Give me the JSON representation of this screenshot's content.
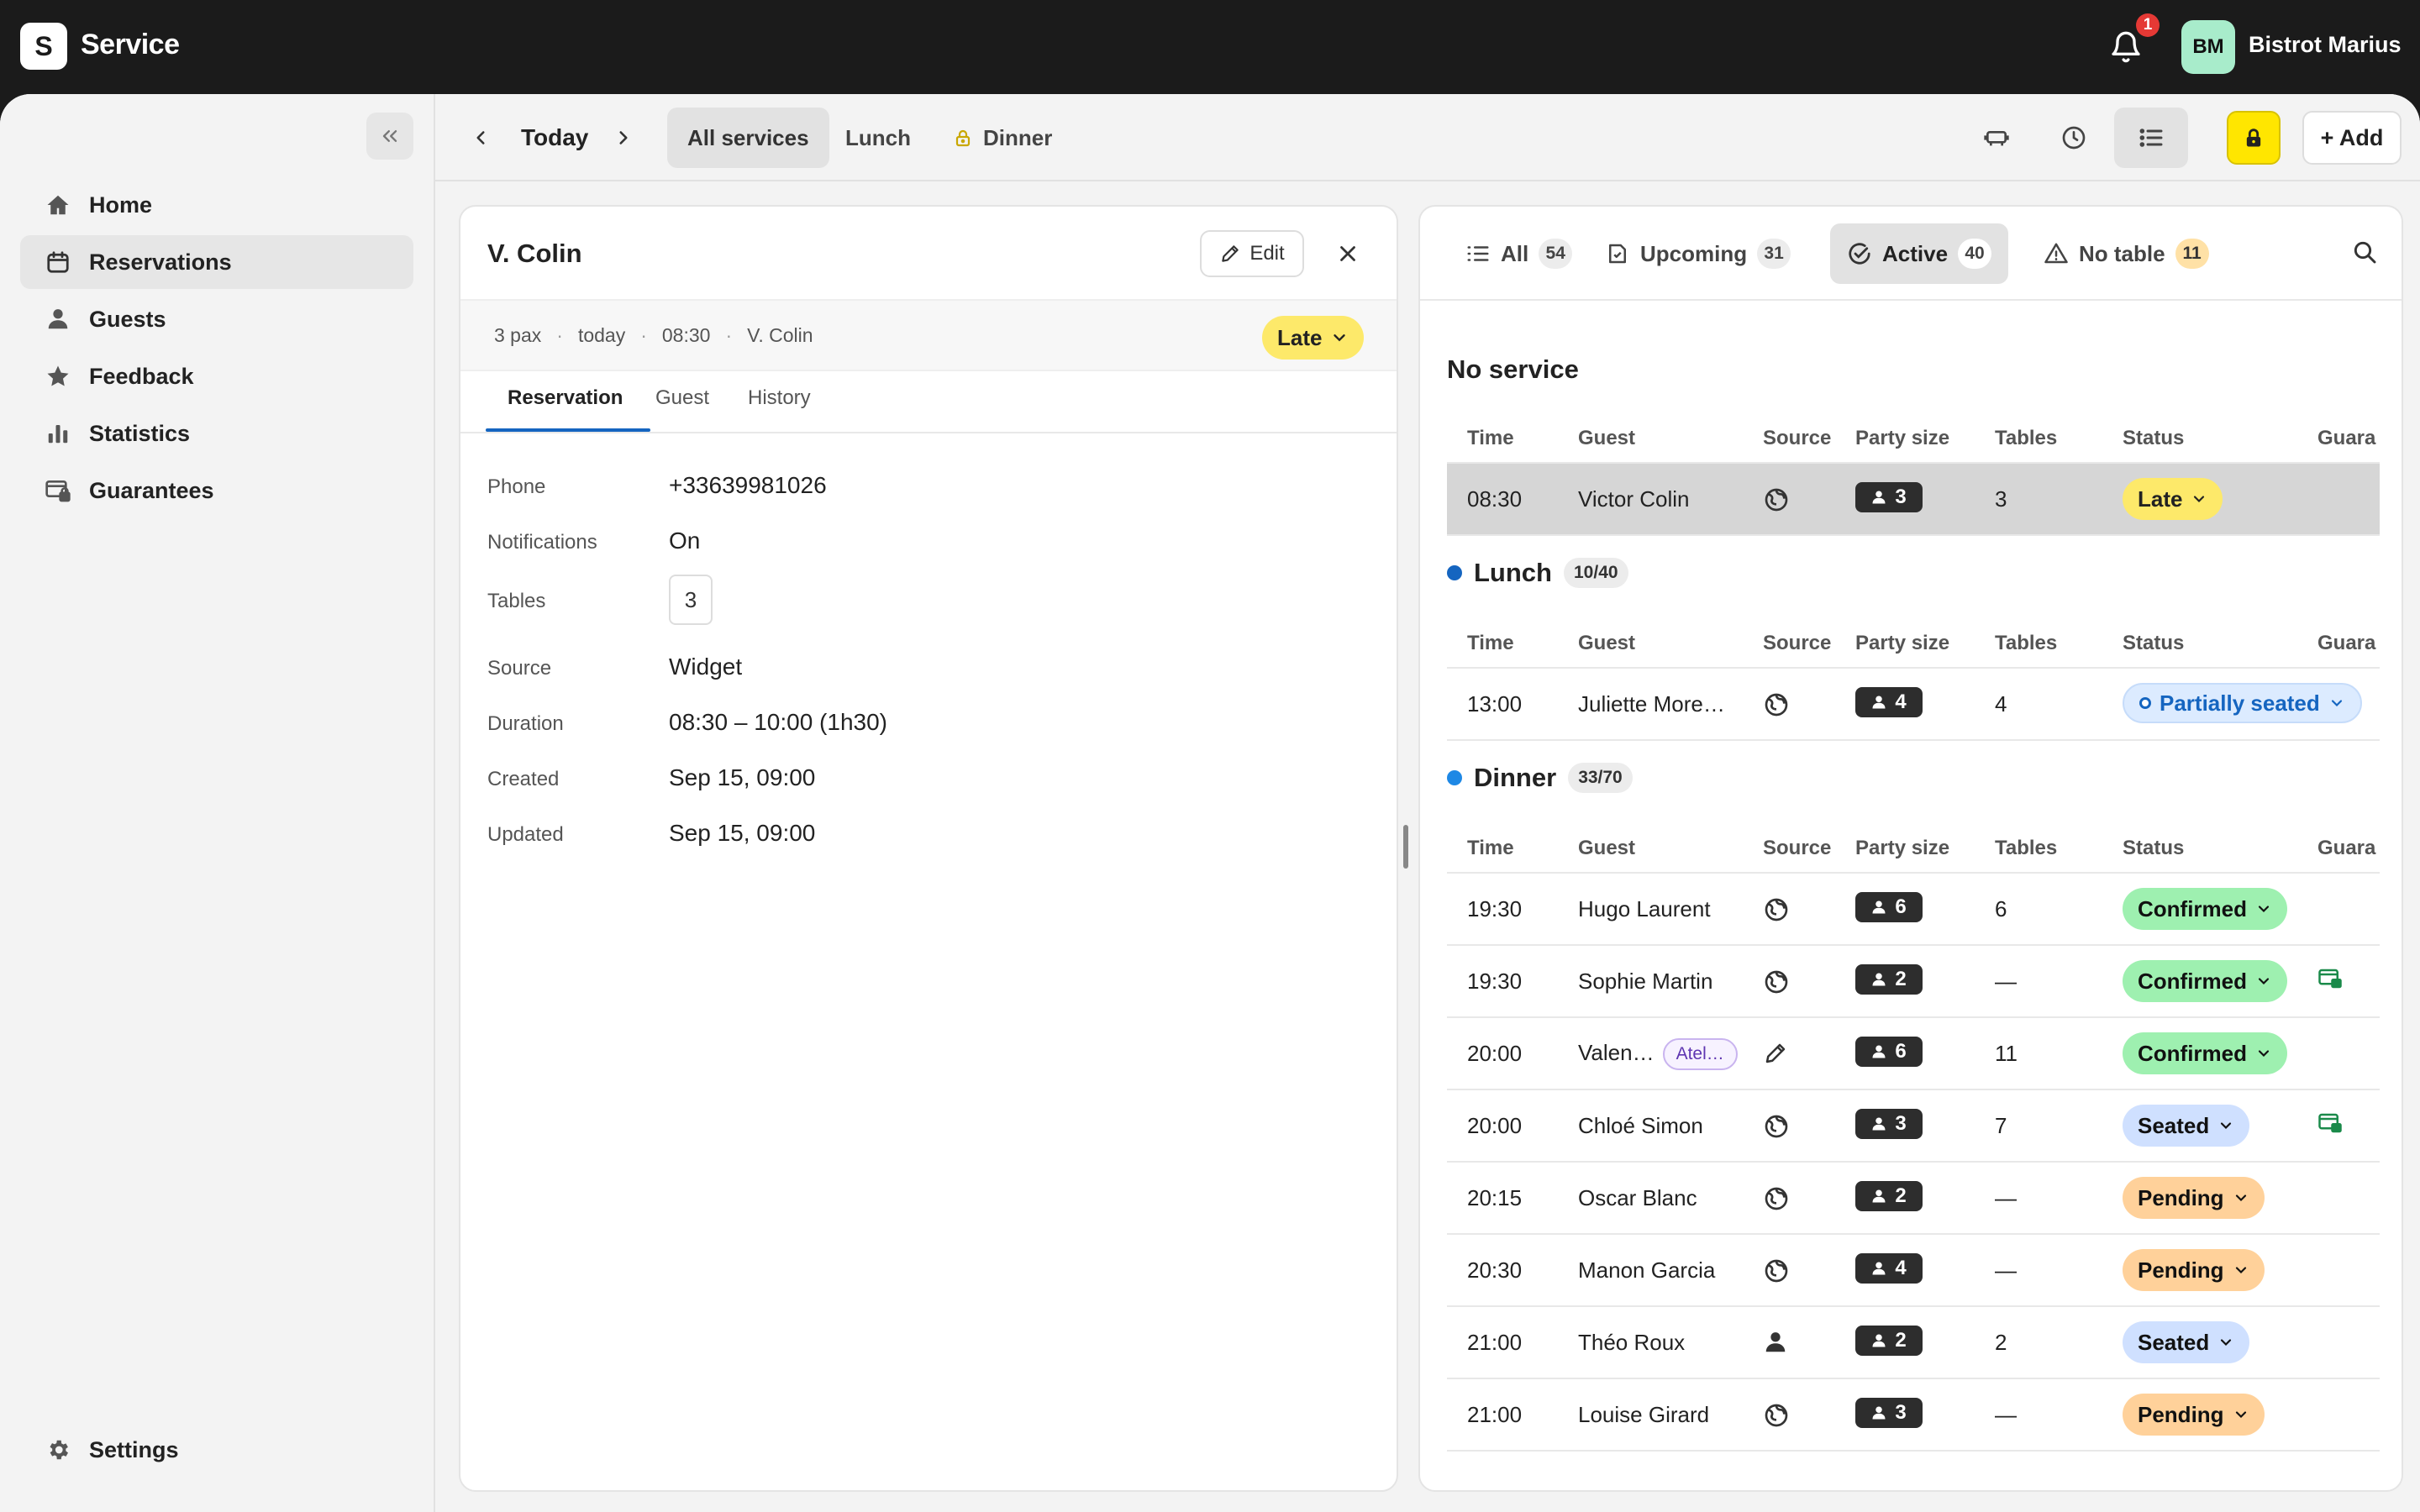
{
  "app": {
    "logo_letter": "S",
    "title": "Service",
    "notification_count": "1",
    "user_initials": "BM",
    "restaurant_name": "Bistrot Marius"
  },
  "sidebar": {
    "items": [
      {
        "label": "Home",
        "icon": "home-icon"
      },
      {
        "label": "Reservations",
        "icon": "calendar-icon",
        "active": true
      },
      {
        "label": "Guests",
        "icon": "person-icon"
      },
      {
        "label": "Feedback",
        "icon": "star-icon"
      },
      {
        "label": "Statistics",
        "icon": "bar-chart-icon"
      },
      {
        "label": "Guarantees",
        "icon": "card-lock-icon"
      }
    ],
    "settings_label": "Settings"
  },
  "subbar": {
    "date_label": "Today",
    "services": [
      "All services",
      "Lunch",
      "Dinner"
    ],
    "add_label": "+ Add"
  },
  "detail": {
    "title": "V. Colin",
    "edit_label": "Edit",
    "summary": {
      "pax": "3 pax",
      "day": "today",
      "time": "08:30",
      "name": "V. Colin"
    },
    "status": "Late",
    "tabs": [
      "Reservation",
      "Guest",
      "History"
    ],
    "fields": {
      "phone": {
        "label": "Phone",
        "value": "+33639981026"
      },
      "notifications": {
        "label": "Notifications",
        "value": "On"
      },
      "tables": {
        "label": "Tables",
        "value": "3"
      },
      "source": {
        "label": "Source",
        "value": "Widget"
      },
      "duration": {
        "label": "Duration",
        "value": "08:30 – 10:00 (1h30)"
      },
      "created": {
        "label": "Created",
        "value": "Sep 15, 09:00"
      },
      "updated": {
        "label": "Updated",
        "value": "Sep 15, 09:00"
      }
    }
  },
  "list": {
    "tabs": [
      {
        "label": "All",
        "count": "54"
      },
      {
        "label": "Upcoming",
        "count": "31"
      },
      {
        "label": "Active",
        "count": "40"
      },
      {
        "label": "No table",
        "count": "11"
      }
    ],
    "columns": [
      "Time",
      "Guest",
      "Source",
      "Party size",
      "Tables",
      "Status",
      "Guara"
    ],
    "no_service": {
      "title": "No service",
      "rows": [
        {
          "time": "08:30",
          "guest": "Victor Colin",
          "party": "3",
          "tables": "3",
          "status": "Late"
        }
      ]
    },
    "lunch": {
      "title": "Lunch",
      "capacity": "10/40",
      "color": "#1565c0",
      "rows": [
        {
          "time": "13:00",
          "guest": "Juliette More…",
          "party": "4",
          "tables": "4",
          "status": "Partially seated"
        }
      ]
    },
    "dinner": {
      "title": "Dinner",
      "capacity": "33/70",
      "color": "#1e88e5",
      "rows": [
        {
          "time": "19:30",
          "guest": "Hugo Laurent",
          "party": "6",
          "tables": "6",
          "status": "Confirmed"
        },
        {
          "time": "19:30",
          "guest": "Sophie Martin",
          "party": "2",
          "tables": "—",
          "status": "Confirmed"
        },
        {
          "time": "20:00",
          "guest": "Valen…",
          "tag": "Atel…",
          "party": "6",
          "tables": "11",
          "status": "Confirmed"
        },
        {
          "time": "20:00",
          "guest": "Chloé Simon",
          "party": "3",
          "tables": "7",
          "status": "Seated"
        },
        {
          "time": "20:15",
          "guest": "Oscar Blanc",
          "party": "2",
          "tables": "—",
          "status": "Pending"
        },
        {
          "time": "20:30",
          "guest": "Manon Garcia",
          "party": "4",
          "tables": "—",
          "status": "Pending"
        },
        {
          "time": "21:00",
          "guest": "Théo Roux",
          "party": "2",
          "tables": "2",
          "status": "Seated"
        },
        {
          "time": "21:00",
          "guest": "Louise Girard",
          "party": "3",
          "tables": "—",
          "status": "Pending"
        }
      ]
    }
  }
}
